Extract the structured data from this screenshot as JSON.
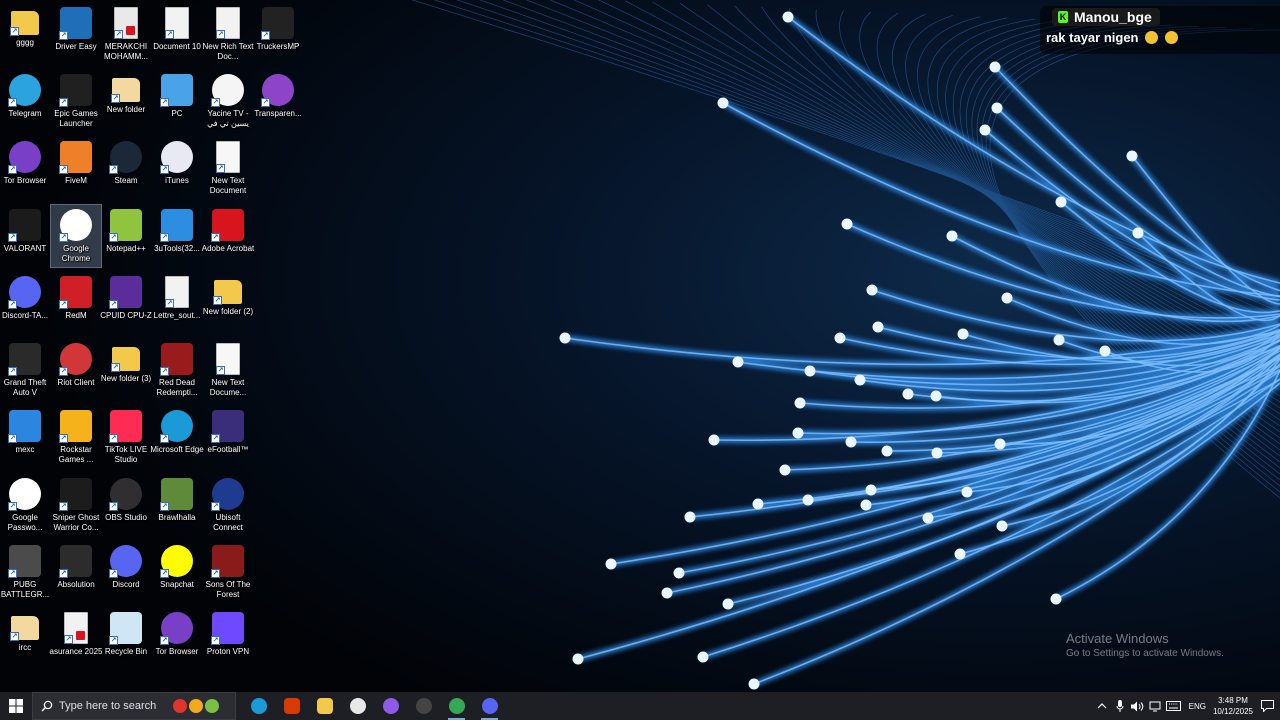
{
  "desktop": {
    "icons": [
      {
        "label": "gggg",
        "icon": "folder-icon",
        "color": "#f3c94c"
      },
      {
        "label": "Driver Easy",
        "icon": "driver-easy-icon",
        "color": "#1f6fb8"
      },
      {
        "label": "MERAKCHI MOHAMM...",
        "icon": "pdf-file-icon",
        "color": "#e9e9e9"
      },
      {
        "label": "Document 10",
        "icon": "document-icon",
        "color": "#f2f2f2"
      },
      {
        "label": "New Rich Text Doc...",
        "icon": "rich-text-icon",
        "color": "#f2f2f2"
      },
      {
        "label": "TruckersMP",
        "icon": "truckersmp-icon",
        "color": "#222222"
      },
      {
        "label": "Telegram",
        "icon": "telegram-icon",
        "color": "#2aa3de"
      },
      {
        "label": "Epic Games Launcher",
        "icon": "epic-games-icon",
        "color": "#202020"
      },
      {
        "label": "New folder",
        "icon": "folder-icon",
        "color": "#f3d9a0"
      },
      {
        "label": "PC",
        "icon": "pc-icon",
        "color": "#4aa3e8"
      },
      {
        "label": "Yacine TV - يسين تي في",
        "icon": "chrome-app-icon",
        "color": "#f5f5f5"
      },
      {
        "label": "Transparen...",
        "icon": "chat-bubble-icon",
        "color": "#8d44c8"
      },
      {
        "label": "Tor Browser",
        "icon": "tor-browser-icon",
        "color": "#7a3fc7"
      },
      {
        "label": "FiveM",
        "icon": "fivem-icon",
        "color": "#f07f2a"
      },
      {
        "label": "Steam",
        "icon": "steam-icon",
        "color": "#1b2838"
      },
      {
        "label": "iTunes",
        "icon": "itunes-icon",
        "color": "#e9e9f3"
      },
      {
        "label": "New Text Document",
        "icon": "text-document-icon",
        "color": "#f7f7f7"
      },
      {
        "label": "VALORANT",
        "icon": "valorant-icon",
        "color": "#1b1b1b"
      },
      {
        "label": "Google Chrome",
        "icon": "chrome-icon",
        "color": "#ffffff"
      },
      {
        "label": "Notepad++",
        "icon": "notepad-plus-icon",
        "color": "#8fc43f"
      },
      {
        "label": "3uTools(32...",
        "icon": "3utools-icon",
        "color": "#2d8de0"
      },
      {
        "label": "Adobe Acrobat",
        "icon": "acrobat-icon",
        "color": "#d8141c"
      },
      {
        "label": "Discord-TA...",
        "icon": "discord-icon",
        "color": "#5865f2"
      },
      {
        "label": "RedM",
        "icon": "redm-icon",
        "color": "#d01f26"
      },
      {
        "label": "CPUID CPU-Z",
        "icon": "cpuz-icon",
        "color": "#5a2d9a"
      },
      {
        "label": "Lettre_sout...",
        "icon": "document-icon",
        "color": "#f2f2f2"
      },
      {
        "label": "New folder (2)",
        "icon": "folder-icon",
        "color": "#f3c94c"
      },
      {
        "label": "Grand Theft Auto V",
        "icon": "gta-v-icon",
        "color": "#2a2a2a"
      },
      {
        "label": "Riot Client",
        "icon": "riot-client-icon",
        "color": "#d13639"
      },
      {
        "label": "New folder (3)",
        "icon": "folder-icon",
        "color": "#f3c94c"
      },
      {
        "label": "Red Dead Redempti...",
        "icon": "red-dead-icon",
        "color": "#9a1b1b"
      },
      {
        "label": "New Text Docume...",
        "icon": "text-document-icon",
        "color": "#f7f7f7"
      },
      {
        "label": "mexc",
        "icon": "mexc-icon",
        "color": "#2b86e0"
      },
      {
        "label": "Rockstar Games ...",
        "icon": "rockstar-icon",
        "color": "#f6b21a"
      },
      {
        "label": "TikTok LIVE Studio",
        "icon": "tiktok-icon",
        "color": "#fe2c55"
      },
      {
        "label": "Microsoft Edge",
        "icon": "edge-icon",
        "color": "#1a9ad6"
      },
      {
        "label": "eFootball™",
        "icon": "efootball-icon",
        "color": "#3a2d7a"
      },
      {
        "label": "Google Passwo...",
        "icon": "google-password-icon",
        "color": "#ffffff"
      },
      {
        "label": "Sniper Ghost Warrior Co...",
        "icon": "sgw-icon",
        "color": "#1c1c1c"
      },
      {
        "label": "OBS Studio",
        "icon": "obs-icon",
        "color": "#302e31"
      },
      {
        "label": "Brawlhalla",
        "icon": "brawlhalla-icon",
        "color": "#5f8a3a"
      },
      {
        "label": "Ubisoft Connect",
        "icon": "ubisoft-icon",
        "color": "#1f3b8f"
      },
      {
        "label": "PUBG BATTLEGR...",
        "icon": "pubg-icon",
        "color": "#4b4b4b"
      },
      {
        "label": "Absolution",
        "icon": "absolution-icon",
        "color": "#2c2c2c"
      },
      {
        "label": "Discord",
        "icon": "discord-icon",
        "color": "#5865f2"
      },
      {
        "label": "Snapchat",
        "icon": "snapchat-icon",
        "color": "#fffc00"
      },
      {
        "label": "Sons Of The Forest",
        "icon": "sons-forest-icon",
        "color": "#8a1b1b"
      },
      {
        "label": "ircc",
        "icon": "folder-icon",
        "color": "#f3d9a0"
      },
      {
        "label": "asurance 2025",
        "icon": "pdf-file-icon",
        "color": "#f2f2f2"
      },
      {
        "label": "Recycle Bin",
        "icon": "recycle-bin-icon",
        "color": "#cfe6f5"
      },
      {
        "label": "Tor Browser",
        "icon": "tor-browser-icon",
        "color": "#7a3fc7"
      },
      {
        "label": "Proton VPN",
        "icon": "proton-vpn-icon",
        "color": "#6d4aff"
      }
    ],
    "selected_icon": "Google Chrome"
  },
  "chat_overlay": {
    "username": "Manou_bge",
    "badge": "K",
    "message": "rak tayar nigen",
    "emoji_count": 2
  },
  "watermark": {
    "title": "Activate Windows",
    "subtitle": "Go to Settings to activate Windows."
  },
  "taskbar": {
    "search_placeholder": "Type here to search",
    "apps": [
      {
        "name": "edge-taskbar",
        "color": "#1a9ad6"
      },
      {
        "name": "office-taskbar",
        "color": "#d83b01"
      },
      {
        "name": "file-explorer-taskbar",
        "color": "#f3c94c"
      },
      {
        "name": "chat-taskbar",
        "color": "#e8e8e8"
      },
      {
        "name": "messenger-taskbar",
        "color": "#8e5be8"
      },
      {
        "name": "obs-taskbar",
        "color": "#444444"
      },
      {
        "name": "chrome-taskbar",
        "color": "#34a853"
      },
      {
        "name": "discord-taskbar",
        "color": "#5865f2"
      }
    ],
    "language": "ENG",
    "time": "3:48 PM",
    "date": "10/12/2025"
  },
  "colors": {
    "wallpaper_bg": "#020811",
    "fiber": "#3c93e6",
    "taskbar_bg": "#1e1f24",
    "accent": "#53fc18"
  }
}
